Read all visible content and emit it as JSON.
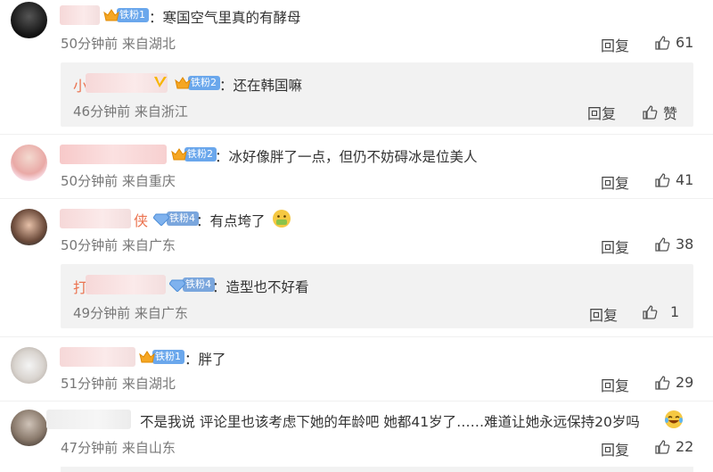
{
  "comments": [
    {
      "name_visible": "",
      "badge": "铁粉1",
      "text": "：寒国空气里真的有酵母",
      "time": "50分钟前",
      "location": "来自湖北",
      "reply_label": "回复",
      "likes": "61"
    },
    {
      "name_visible": "小",
      "badge": "铁粉2",
      "text": "：还在韩国嘛",
      "time": "46分钟前",
      "location": "来自浙江",
      "reply_label": "回复",
      "likes": "赞"
    },
    {
      "name_visible": "",
      "badge": "铁粉2",
      "text": "：冰好像胖了一点，但仍不妨碍冰是位美人",
      "time": "50分钟前",
      "location": "来自重庆",
      "reply_label": "回复",
      "likes": "41"
    },
    {
      "name_visible": "侠",
      "badge": "铁粉4",
      "text": "：有点垮了",
      "time": "50分钟前",
      "location": "来自广东",
      "reply_label": "回复",
      "likes": "38"
    },
    {
      "name_visible": "打",
      "badge": "铁粉4",
      "text": "：造型也不好看",
      "time": "49分钟前",
      "location": "来自广东",
      "reply_label": "回复",
      "likes": "1"
    },
    {
      "name_visible": "",
      "badge": "铁粉1",
      "text": "：胖了",
      "time": "51分钟前",
      "location": "来自湖北",
      "reply_label": "回复",
      "likes": "29"
    },
    {
      "name_visible": "",
      "badge": "",
      "text": "不是我说 评论里也该考虑下她的年龄吧 她都41岁了……难道让她永远保持20岁吗",
      "time": "47分钟前",
      "location": "来自山东",
      "reply_label": "回复",
      "likes": "22"
    }
  ],
  "colors": {
    "accent": "#eb7350",
    "badge_gold": "#6aa7ec",
    "badge_blue": "#7aa6dd",
    "subbg": "#f2f2f2"
  }
}
